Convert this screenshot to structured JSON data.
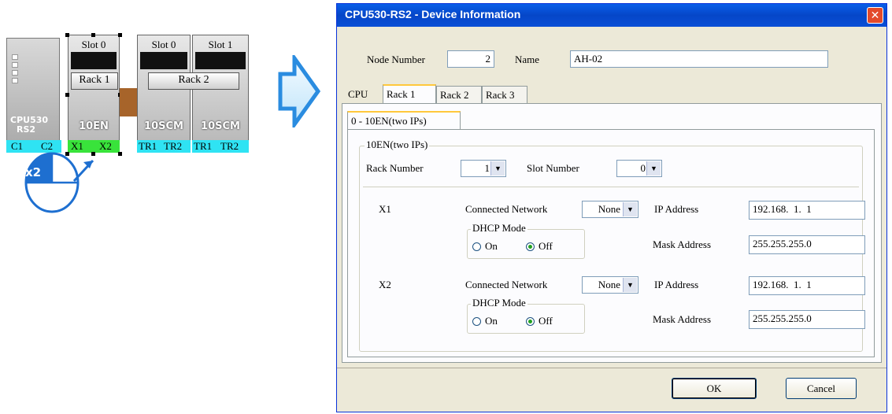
{
  "diagram": {
    "cpu": {
      "label_line1": "CPU530",
      "label_line2": "RS2",
      "ports": [
        "C1",
        "C2"
      ]
    },
    "rack1": {
      "label": "Rack 1",
      "slots": [
        {
          "slot": "Slot 0",
          "module": "10EN",
          "ports": [
            "X1",
            "X2"
          ]
        }
      ]
    },
    "rack2": {
      "label": "Rack 2",
      "slots": [
        {
          "slot": "Slot 0",
          "module": "10SCM",
          "ports": [
            "TR1",
            "TR2"
          ]
        },
        {
          "slot": "Slot 1",
          "module": "10SCM",
          "ports": [
            "TR1",
            "TR2"
          ]
        }
      ]
    },
    "double_click_badge": "x2"
  },
  "dialog": {
    "title": "CPU530-RS2 - Device Information",
    "node_number_label": "Node Number",
    "node_number_value": "2",
    "name_label": "Name",
    "name_value": "AH-02",
    "tabs": [
      "CPU",
      "Rack 1",
      "Rack 2",
      "Rack 3"
    ],
    "active_tab": "Rack 1",
    "subtabs": [
      "0 - 10EN(two IPs)"
    ],
    "group_title": "10EN(two IPs)",
    "rack_number_label": "Rack Number",
    "rack_number_value": "1",
    "slot_number_label": "Slot Number",
    "slot_number_value": "0",
    "ports": [
      {
        "name": "X1",
        "connected_network_label": "Connected Network",
        "connected_network_value": "None",
        "dhcp_mode_label": "DHCP Mode",
        "dhcp_on_label": "On",
        "dhcp_off_label": "Off",
        "dhcp_selected": "Off",
        "ip_address_label": "IP Address",
        "ip_address_value": "192.168.  1.  1",
        "mask_address_label": "Mask Address",
        "mask_address_value": "255.255.255.0"
      },
      {
        "name": "X2",
        "connected_network_label": "Connected Network",
        "connected_network_value": "None",
        "dhcp_mode_label": "DHCP Mode",
        "dhcp_on_label": "On",
        "dhcp_off_label": "Off",
        "dhcp_selected": "Off",
        "ip_address_label": "IP Address",
        "ip_address_value": "192.168.  1.  1",
        "mask_address_label": "Mask Address",
        "mask_address_value": "255.255.255.0"
      }
    ],
    "ok_label": "OK",
    "cancel_label": "Cancel"
  },
  "colors": {
    "titlebar": "#0a5fe8",
    "dialog_bg": "#ece9d8",
    "cpu_port_strip": "#2fe3f3",
    "selected_port_strip": "#39e33b",
    "arrow": "#2a8ce0"
  }
}
